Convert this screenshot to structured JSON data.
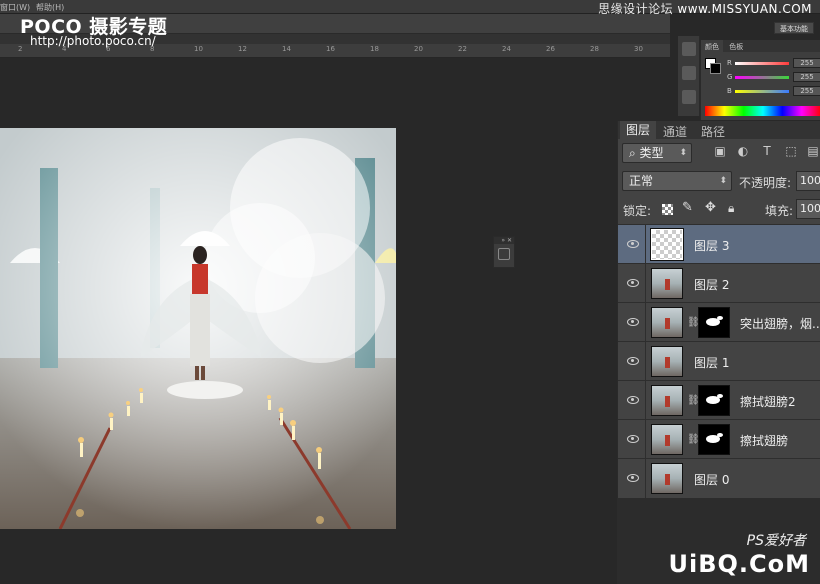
{
  "menubar": {
    "items": [
      "窗口(W)",
      "帮助(H)"
    ]
  },
  "watermark_top": {
    "text": "思缘设计论坛",
    "url": "www.MISSYUAN.COM"
  },
  "logo": {
    "brand": "POCO 摄影专题",
    "url": "http://photo.poco.cn/"
  },
  "color_panel": {
    "tabs": [
      "颜色",
      "色板"
    ],
    "basic_button": "基本功能",
    "rows": [
      {
        "label": "R",
        "value": "255",
        "color": "#ff3b3b"
      },
      {
        "label": "G",
        "value": "255",
        "color": "#39d839"
      },
      {
        "label": "B",
        "value": "255",
        "color": "#3b7bff"
      }
    ]
  },
  "layers_panel": {
    "tabs": [
      "图层",
      "通道",
      "路径"
    ],
    "filter_kind": "类型",
    "blend_mode": "正常",
    "opacity_label": "不透明度:",
    "opacity_value": "100",
    "lock_label": "锁定:",
    "fill_label": "填充:",
    "fill_value": "100",
    "layers": [
      {
        "name": "图层 3",
        "thumb": "transparent",
        "mask": false,
        "selected": true
      },
      {
        "name": "图层 2",
        "thumb": "photo",
        "mask": false,
        "selected": false
      },
      {
        "name": "突出翅膀，烟...",
        "thumb": "photo",
        "mask": true,
        "selected": false
      },
      {
        "name": "图层 1",
        "thumb": "photo",
        "mask": false,
        "selected": false
      },
      {
        "name": "擦拭翅膀2",
        "thumb": "photo",
        "mask": true,
        "selected": false
      },
      {
        "name": "擦拭翅膀",
        "thumb": "photo",
        "mask": true,
        "selected": false
      },
      {
        "name": "图层 0",
        "thumb": "photo",
        "mask": false,
        "selected": false
      }
    ]
  },
  "watermark_bottom": {
    "ps_text": "PS爱好者",
    "site": "UiBQ.CoM"
  },
  "accent": {
    "selected_layer": "#5d6b80",
    "panel_bg": "#434343",
    "workspace_bg": "#282828"
  }
}
